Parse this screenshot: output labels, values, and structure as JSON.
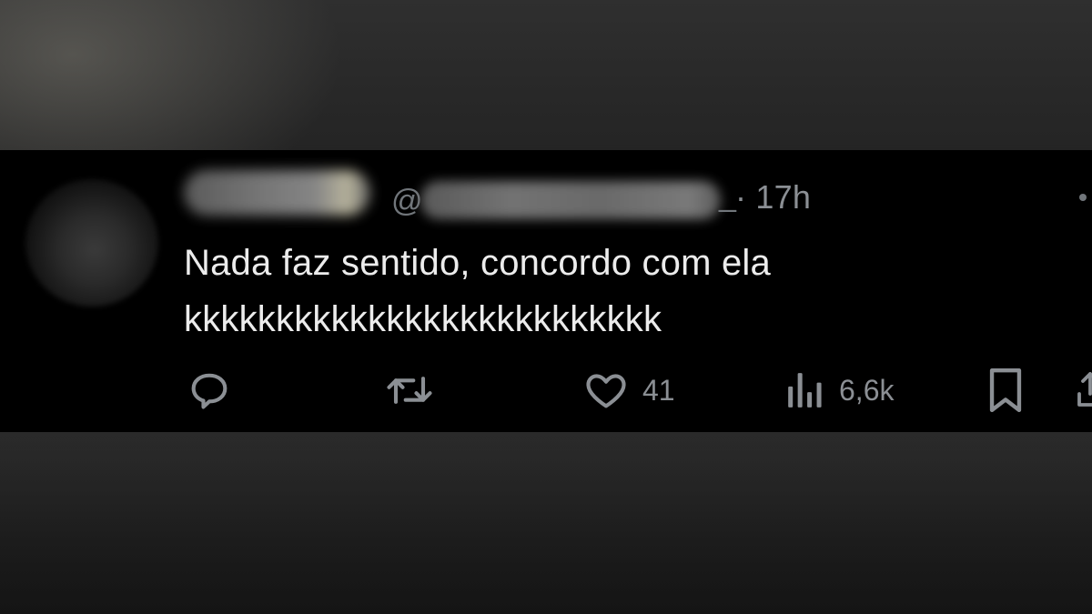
{
  "tweet": {
    "handle_prefix": "@",
    "handle_suffix": "_",
    "timestamp": "· 17h",
    "text": "Nada faz sentido, concordo com ela\nkkkkkkkkkkkkkkkkkkkkkkkkkk"
  },
  "actions": {
    "reply_icon": "reply-icon",
    "retweet_icon": "retweet-icon",
    "like_icon": "heart-icon",
    "likes": "41",
    "views_icon": "views-icon",
    "views": "6,6k",
    "bookmark_icon": "bookmark-icon",
    "share_icon": "share-icon"
  },
  "colors": {
    "background": "#000000",
    "text": "#ececec",
    "muted": "#8b8f94"
  }
}
